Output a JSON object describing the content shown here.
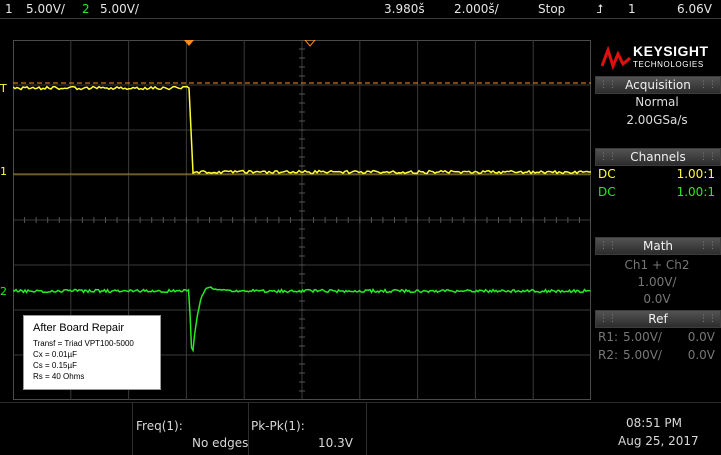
{
  "status_bar": {
    "ch1_num": "1",
    "ch1_scale": "5.00V/",
    "ch2_num": "2",
    "ch2_scale": "5.00V/",
    "delay": "3.980š",
    "timebase": "2.000š/",
    "run_state": "Stop",
    "trigger_icon": "trigger-edge-icon",
    "trigger_src": "1",
    "trigger_level": "6.06V"
  },
  "markers": {
    "ch1_ground": "1",
    "ch2_ground": "2",
    "trigger_level": "T"
  },
  "logo": {
    "brand": "KEYSIGHT",
    "sub": "TECHNOLOGIES"
  },
  "acquisition": {
    "header": "Acquisition",
    "mode": "Normal",
    "rate": "2.00GSa/s"
  },
  "channels": {
    "header": "Channels",
    "rows": [
      {
        "coupling": "DC",
        "probe": "1.00:1",
        "color": "#ffff33"
      },
      {
        "coupling": "DC",
        "probe": "1.00:1",
        "color": "#22ee22"
      }
    ]
  },
  "math": {
    "header": "Math",
    "function": "Ch1 + Ch2",
    "scale": "1.00V/",
    "offset": "0.0V"
  },
  "ref": {
    "header": "Ref",
    "r1_label": "R1:",
    "r1_scale": "5.00V/",
    "r1_offset": "0.0V",
    "r2_label": "R2:",
    "r2_scale": "5.00V/",
    "r2_offset": "0.0V"
  },
  "annotation": {
    "title": "After Board Repair",
    "lines": [
      "Transf = Triad VPT100-5000",
      "Cx = 0.01µF",
      "Cs = 0.15µF",
      "Rs = 40 Ohms"
    ]
  },
  "measurements": {
    "m1_label": "Freq(1):",
    "m1_value": "No edges",
    "m2_label": "Pk-Pk(1):",
    "m2_value": "10.3V"
  },
  "clock": {
    "time": "08:51 PM",
    "date": "Aug 25, 2017"
  },
  "colors": {
    "ch1": "#ffff33",
    "ch2": "#22ee22",
    "trigger": "#ff8c1a"
  }
}
